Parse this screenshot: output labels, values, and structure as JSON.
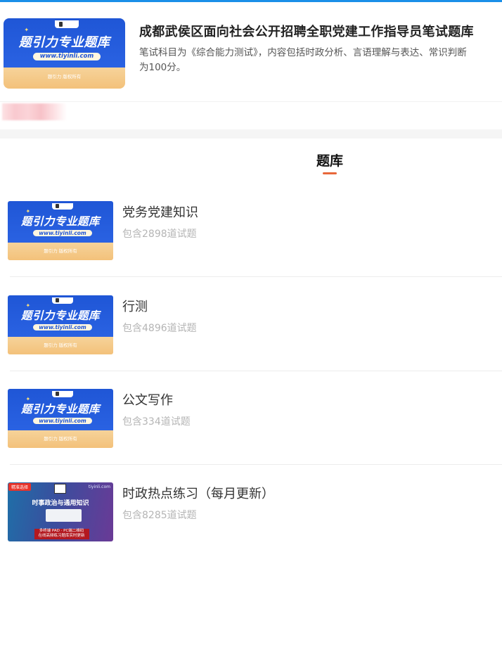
{
  "paper": {
    "title": "成都武侯区面向社会公开招聘全职党建工作指导员笔试题库",
    "description_line1": "笔试科目为《综合能力测试》，内容包括时政分析、言语理解与表达、常识判断",
    "description_line2": "为100分。"
  },
  "cover": {
    "brand": "题引力专业题库",
    "url": "www.tiyinli.com",
    "copyright": "题引力 版权所有"
  },
  "section": {
    "title": "题库"
  },
  "items": [
    {
      "name": "党务党建知识",
      "count": "包含2898道试题",
      "thumb": "brand"
    },
    {
      "name": "行测",
      "count": "包含4896道试题",
      "thumb": "brand"
    },
    {
      "name": "公文写作",
      "count": "包含334道试题",
      "thumb": "brand"
    },
    {
      "name": "时政热点练习（每月更新）",
      "count": "包含8285道试题",
      "thumb": "news"
    }
  ],
  "news_thumb": {
    "flag": "精准选择",
    "site": "tiyinli.com",
    "headline": "时事政治与通用知识",
    "banner_line1": "多终端 PAD · PC端二维码",
    "banner_line2": "在线高频练习题库实时更新"
  },
  "colors": {
    "accent": "#e8673a",
    "top_bar": "#1a8fe8",
    "brand_blue": "#1f56d6"
  }
}
